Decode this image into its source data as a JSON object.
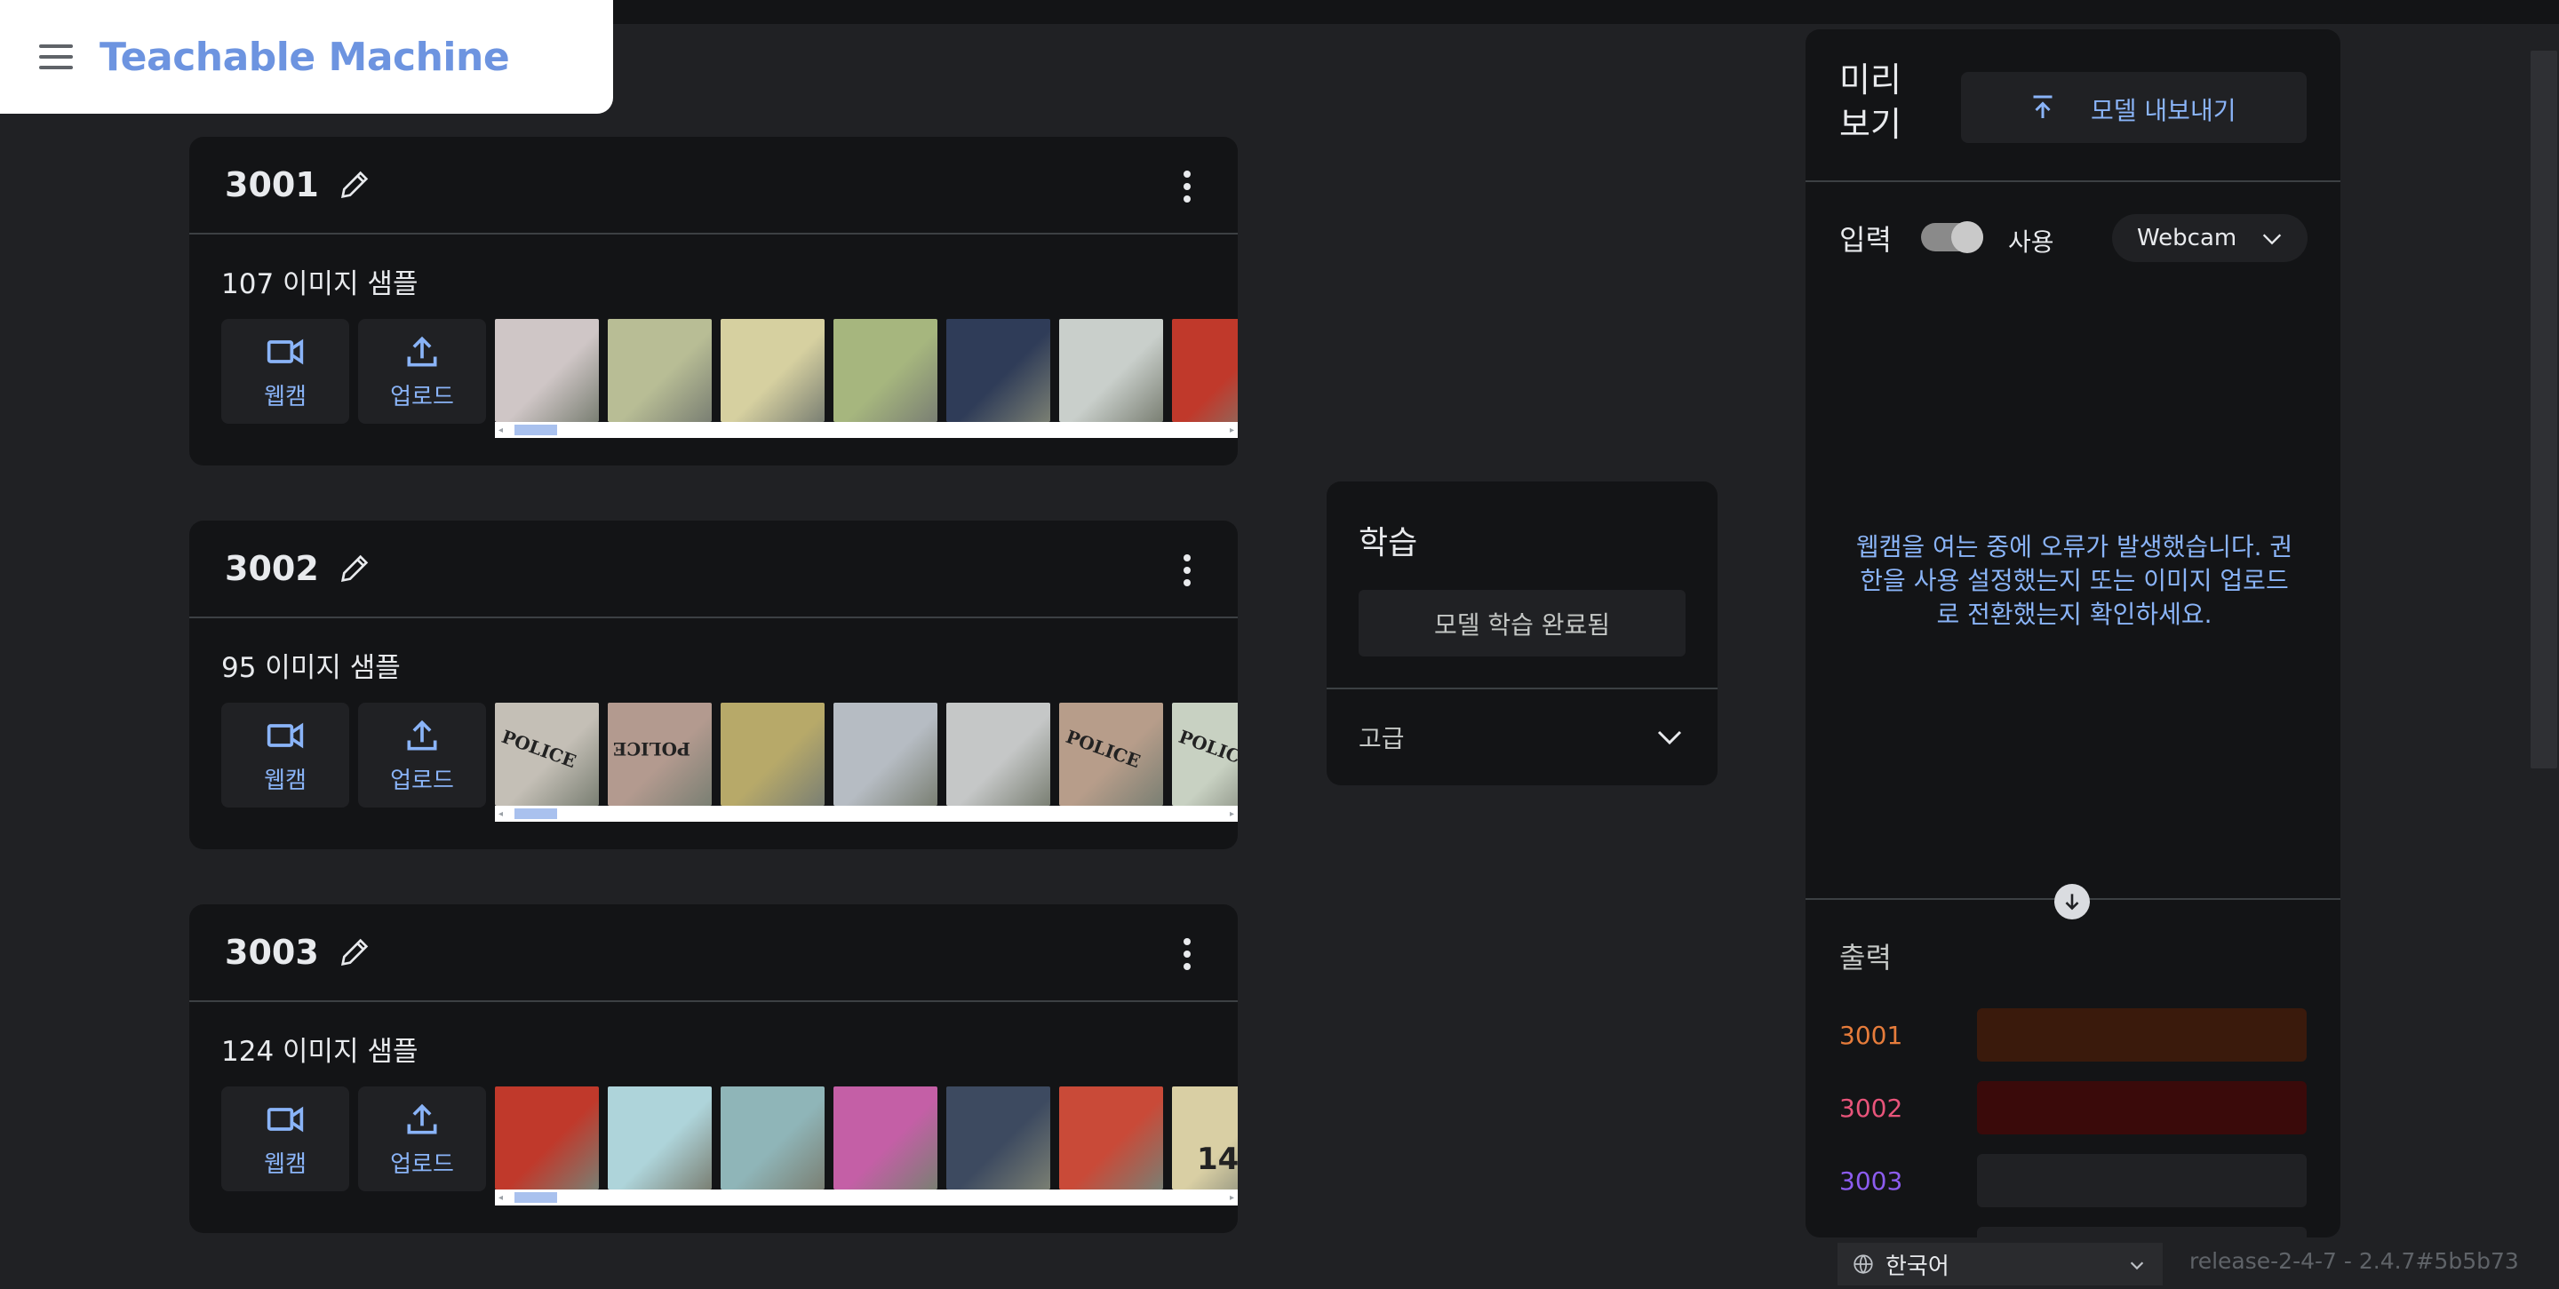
{
  "app": {
    "title": "Teachable Machine"
  },
  "colors": {
    "accent": "#8ab4f8",
    "brand": "#6d94e0"
  },
  "classes": [
    {
      "name": "3001",
      "samples_label": "107 이미지 샘플",
      "webcam_label": "웹캠",
      "upload_label": "업로드",
      "thumbnails": [
        "#cfc6c6",
        "#b8bd95",
        "#d6d0a0",
        "#a6b67e",
        "#2f3c58",
        "#c9cfcb",
        "#c0392b"
      ]
    },
    {
      "name": "3002",
      "samples_label": "95 이미지 샘플",
      "webcam_label": "웹캠",
      "upload_label": "업로드",
      "thumbnails": [
        "#c4bfb6",
        "#b39a8f",
        "#b7a969",
        "#b6bcc3",
        "#c5c7c7",
        "#b79d8a",
        "#c8d1c2"
      ]
    },
    {
      "name": "3003",
      "samples_label": "124 이미지 샘플",
      "webcam_label": "웹캠",
      "upload_label": "업로드",
      "thumbnails": [
        "#c0392b",
        "#aed4da",
        "#8fb5b8",
        "#c45fa6",
        "#3d4a60",
        "#c94a38",
        "#d9cfa4"
      ]
    }
  ],
  "thumb_texts": {
    "police": "POLICE",
    "number14": "14"
  },
  "training": {
    "title": "학습",
    "status_button": "모델 학습 완료됨",
    "advanced_label": "고급"
  },
  "preview": {
    "title": "미리 보기",
    "export_button": "모델 내보내기",
    "input_label": "입력",
    "toggle_label": "사용",
    "toggle_on": true,
    "source_selected": "Webcam",
    "webcam_error": "웹캠을 여는 중에 오류가 발생했습니다. 권한을 사용 설정했는지 또는 이미지 업로드로 전환했는지 확인하세요.",
    "output_label": "출력",
    "outputs": [
      {
        "name": "3001",
        "color": "#e67c3b",
        "bar_color": "#3a1a0c"
      },
      {
        "name": "3002",
        "color": "#e8547a",
        "bar_color": "#3a0a0a"
      },
      {
        "name": "3003",
        "color": "#8c5cf0",
        "bar_color": "#202124"
      }
    ]
  },
  "footer": {
    "language": "한국어",
    "release": "release-2-4-7 - 2.4.7#5b5b73"
  }
}
